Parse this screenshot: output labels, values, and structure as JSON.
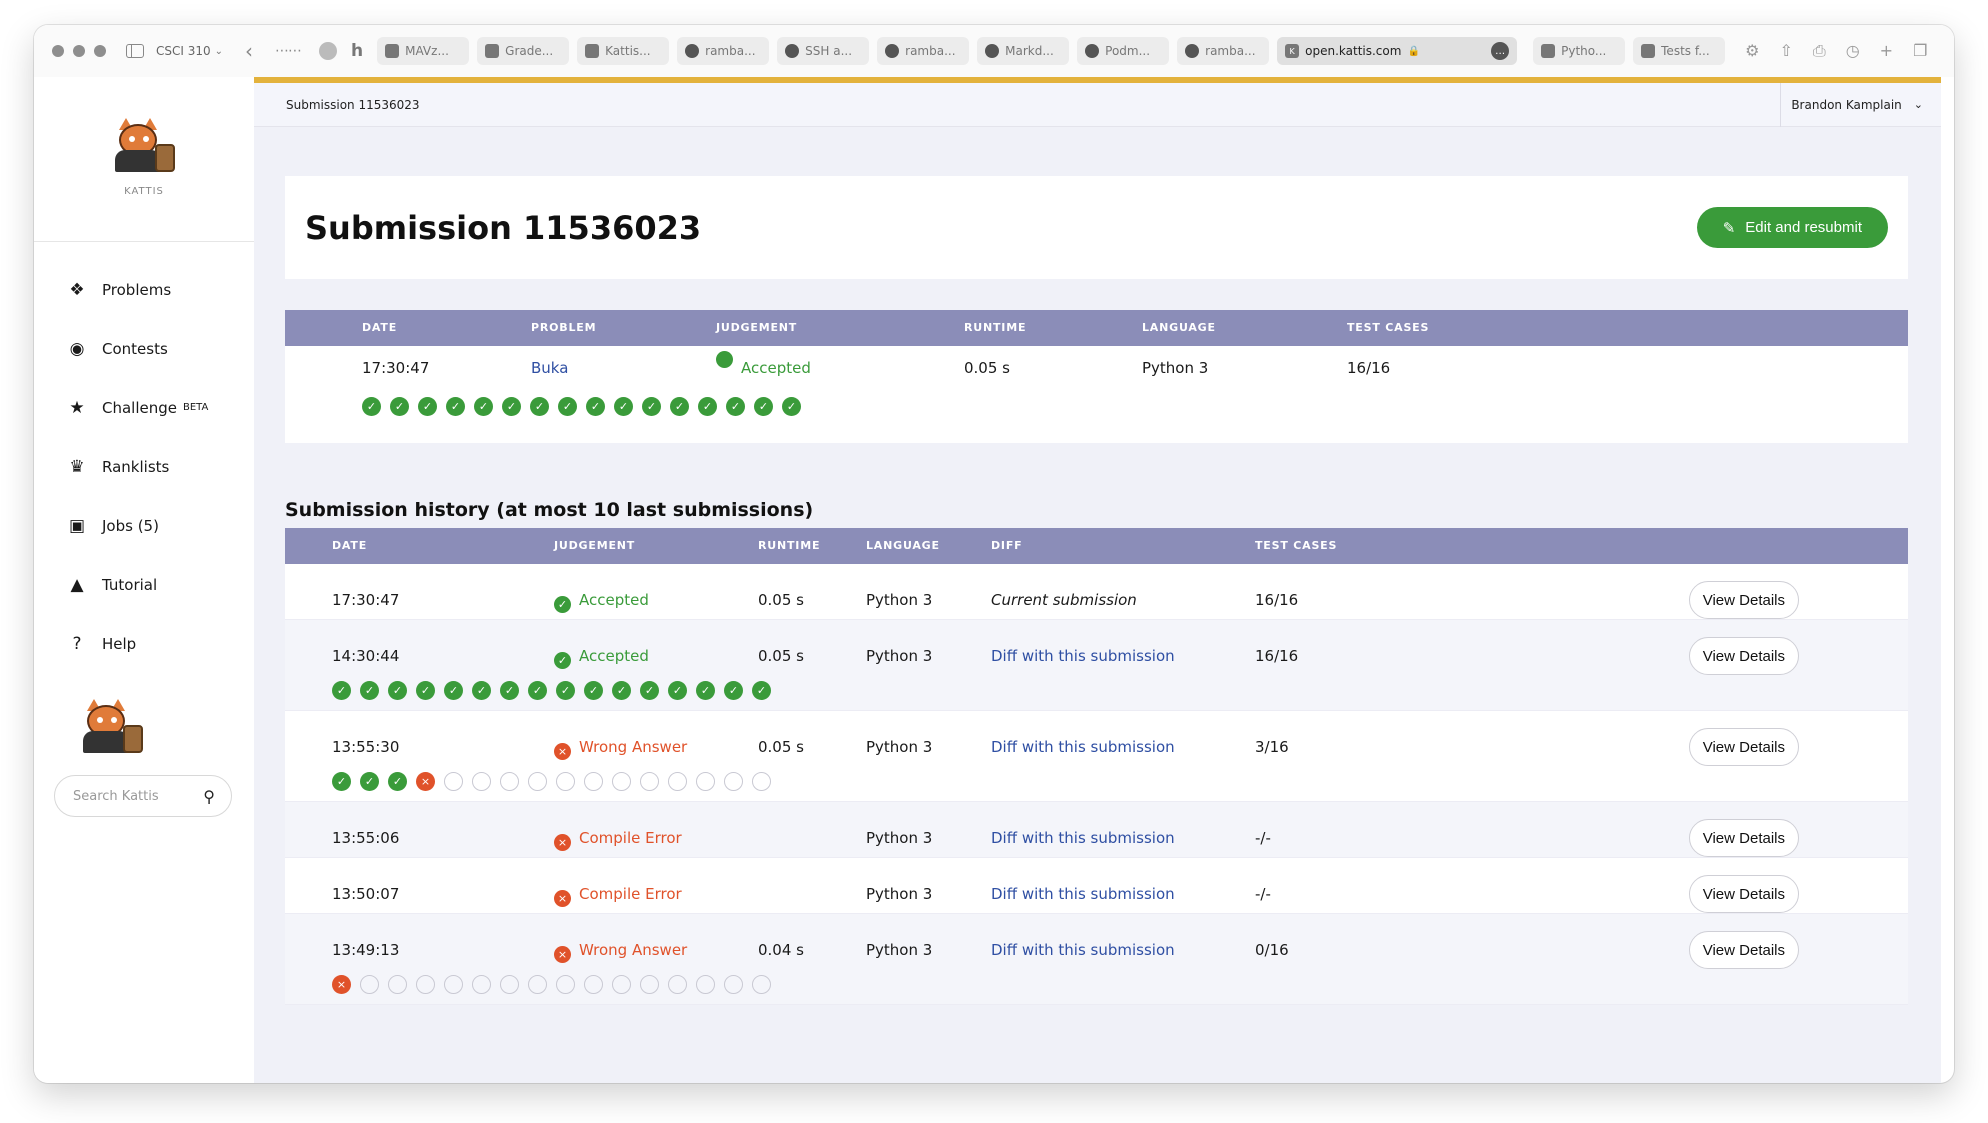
{
  "browser": {
    "tab_group": "CSCI 310",
    "tabs": [
      {
        "label": "MAVz...",
        "icon": "document-icon"
      },
      {
        "label": "Grade...",
        "icon": "grade-icon"
      },
      {
        "label": "Kattis...",
        "icon": "page-icon"
      },
      {
        "label": "ramba...",
        "icon": "github-icon"
      },
      {
        "label": "SSH a...",
        "icon": "github-icon"
      },
      {
        "label": "ramba...",
        "icon": "github-icon"
      },
      {
        "label": "Markd...",
        "icon": "github-icon"
      },
      {
        "label": "Podm...",
        "icon": "github-icon"
      },
      {
        "label": "ramba...",
        "icon": "github-icon"
      }
    ],
    "active_tab": "open.kattis.com",
    "tabs_after": [
      {
        "label": "Pytho...",
        "icon": "python-icon"
      },
      {
        "label": "Tests f...",
        "icon": "page-icon"
      }
    ]
  },
  "sidebar": {
    "logo_text": "KATTIS",
    "items": [
      {
        "label": "Problems",
        "icon": "brain-icon"
      },
      {
        "label": "Contests",
        "icon": "award-icon"
      },
      {
        "label": "Challenge",
        "icon": "star-icon",
        "sup": "BETA"
      },
      {
        "label": "Ranklists",
        "icon": "trophy-icon"
      },
      {
        "label": "Jobs (5)",
        "icon": "briefcase-icon"
      },
      {
        "label": "Tutorial",
        "icon": "graduation-cap-icon"
      },
      {
        "label": "Help",
        "icon": "question-icon"
      }
    ],
    "search_placeholder": "Search Kattis"
  },
  "topbar": {
    "breadcrumb": "Submission 11536023",
    "user": "Brandon Kamplain"
  },
  "page": {
    "title": "Submission 11536023",
    "edit_button": "Edit and resubmit"
  },
  "summary": {
    "headers": [
      "DATE",
      "PROBLEM",
      "JUDGEMENT",
      "RUNTIME",
      "LANGUAGE",
      "TEST CASES"
    ],
    "date": "17:30:47",
    "problem": "Buka",
    "judgement": "Accepted",
    "runtime": "0.05 s",
    "language": "Python 3",
    "test_cases": "16/16",
    "results": [
      "p",
      "p",
      "p",
      "p",
      "p",
      "p",
      "p",
      "p",
      "p",
      "p",
      "p",
      "p",
      "p",
      "p",
      "p",
      "p"
    ]
  },
  "history": {
    "title": "Submission history (at most 10 last submissions)",
    "headers": [
      "DATE",
      "JUDGEMENT",
      "RUNTIME",
      "LANGUAGE",
      "DIFF",
      "TEST CASES"
    ],
    "view_label": "View Details",
    "rows": [
      {
        "date": "17:30:47",
        "judgement": "Accepted",
        "status": "ok",
        "runtime": "0.05 s",
        "language": "Python 3",
        "diff": "Current submission",
        "test_cases": "16/16",
        "results": []
      },
      {
        "date": "14:30:44",
        "judgement": "Accepted",
        "status": "ok",
        "runtime": "0.05 s",
        "language": "Python 3",
        "diff": "Diff with this submission",
        "test_cases": "16/16",
        "results": [
          "p",
          "p",
          "p",
          "p",
          "p",
          "p",
          "p",
          "p",
          "p",
          "p",
          "p",
          "p",
          "p",
          "p",
          "p",
          "p"
        ]
      },
      {
        "date": "13:55:30",
        "judgement": "Wrong Answer",
        "status": "bad",
        "runtime": "0.05 s",
        "language": "Python 3",
        "diff": "Diff with this submission",
        "test_cases": "3/16",
        "results": [
          "p",
          "p",
          "p",
          "f",
          "n",
          "n",
          "n",
          "n",
          "n",
          "n",
          "n",
          "n",
          "n",
          "n",
          "n",
          "n"
        ]
      },
      {
        "date": "13:55:06",
        "judgement": "Compile Error",
        "status": "bad",
        "runtime": "",
        "language": "Python 3",
        "diff": "Diff with this submission",
        "test_cases": "-/-",
        "results": []
      },
      {
        "date": "13:50:07",
        "judgement": "Compile Error",
        "status": "bad",
        "runtime": "",
        "language": "Python 3",
        "diff": "Diff with this submission",
        "test_cases": "-/-",
        "results": []
      },
      {
        "date": "13:49:13",
        "judgement": "Wrong Answer",
        "status": "bad",
        "runtime": "0.04 s",
        "language": "Python 3",
        "diff": "Diff with this submission",
        "test_cases": "0/16",
        "results": [
          "f",
          "n",
          "n",
          "n",
          "n",
          "n",
          "n",
          "n",
          "n",
          "n",
          "n",
          "n",
          "n",
          "n",
          "n",
          "n"
        ]
      }
    ]
  },
  "colors": {
    "accent": "#e3b23c",
    "header": "#8b8db8",
    "ok": "#3a9b3a",
    "bad": "#e0522a",
    "link": "#2f4fa3"
  }
}
